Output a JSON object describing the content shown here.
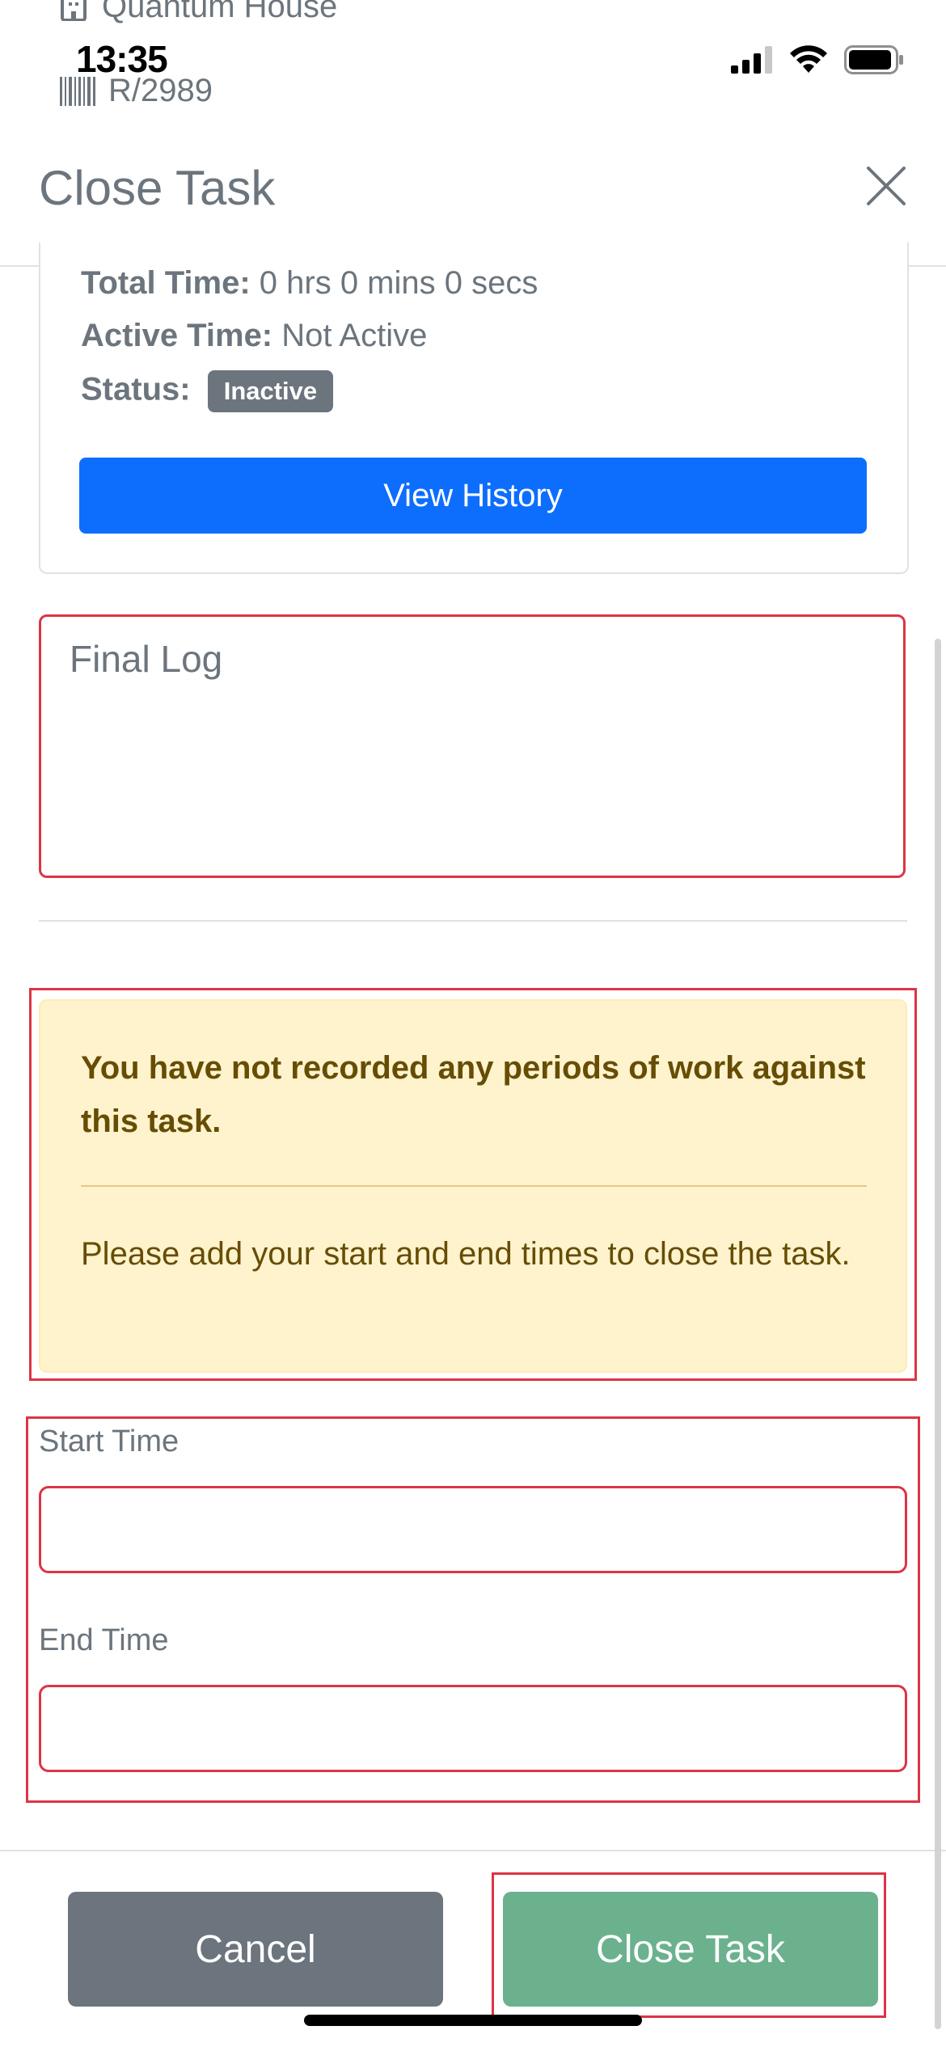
{
  "background": {
    "location": "Quantum House",
    "reference": "R/2989"
  },
  "status_bar": {
    "time": "13:35",
    "icons": [
      "cellular-signal-icon",
      "wifi-icon",
      "battery-icon"
    ]
  },
  "modal": {
    "title": "Close Task",
    "close_icon": "close-icon"
  },
  "info": {
    "total_time_label": "Total Time:",
    "total_time_value": "0 hrs 0 mins 0 secs",
    "active_time_label": "Active Time:",
    "active_time_value": "Not Active",
    "status_label": "Status:",
    "status_badge": "Inactive",
    "view_history": "View History"
  },
  "final_log": {
    "placeholder": "Final Log"
  },
  "alert": {
    "heading": "You have not recorded any periods of work against this task.",
    "body": "Please add your start and end times to close the task."
  },
  "times": {
    "start_label": "Start Time",
    "start_value": "",
    "end_label": "End Time",
    "end_value": ""
  },
  "footer": {
    "cancel": "Cancel",
    "close_task": "Close Task"
  },
  "colors": {
    "primary": "#0d6efd",
    "secondary": "#6c757d",
    "success_disabled": "#6bb18e",
    "danger": "#dc3545",
    "warning_bg": "#fff3cd",
    "warning_text": "#664d03"
  }
}
